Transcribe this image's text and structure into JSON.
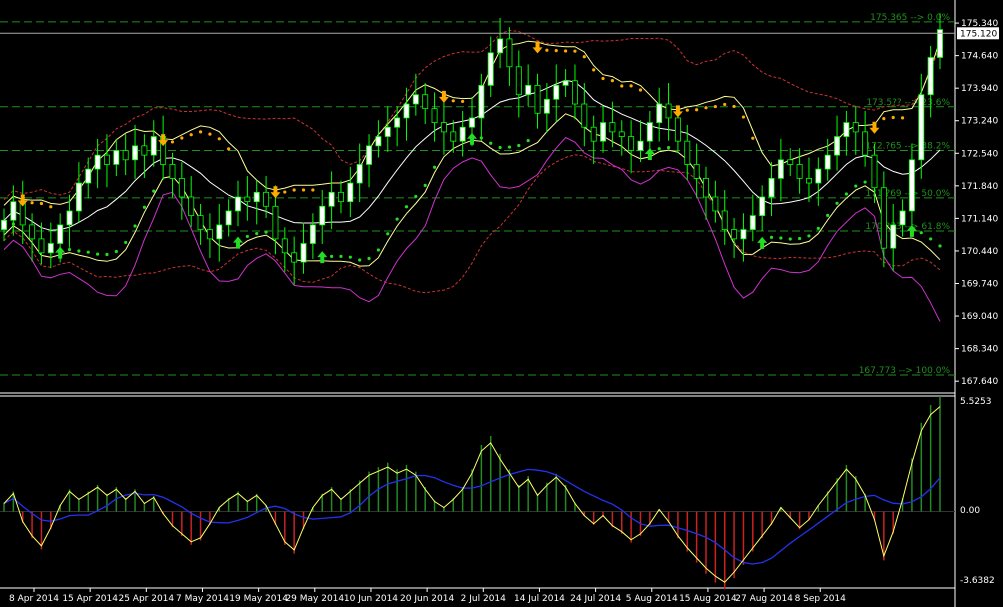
{
  "chart_data": [
    {
      "type": "candlestick",
      "panel": "price",
      "y_ticks": [
        "175.340",
        "174.640",
        "173.940",
        "173.240",
        "172.540",
        "171.840",
        "171.140",
        "170.440",
        "169.740",
        "169.040",
        "168.340",
        "167.640"
      ],
      "y_tick_values": [
        175.34,
        174.64,
        173.94,
        173.24,
        172.54,
        171.84,
        171.14,
        170.44,
        169.74,
        169.04,
        168.34,
        167.64
      ],
      "ylim": [
        167.45,
        175.75
      ],
      "current_price": "175.120",
      "current_price_value": 175.12,
      "fib_levels": [
        {
          "label": "175.365 --> 0.0%",
          "value": 175.365
        },
        {
          "label": "173.5?? --> 23.6%",
          "value": 173.54
        },
        {
          "label": "172.?65 --> 38.2%",
          "value": 172.6
        },
        {
          "label": "171.?69 --> 50.0%",
          "value": 171.58
        },
        {
          "label": "170.?73 --> 61.8%",
          "value": 170.87
        },
        {
          "label": "167.773 --> 100.0%",
          "value": 167.773
        }
      ],
      "closes": [
        171.1,
        171.5,
        171.0,
        170.7,
        170.4,
        170.6,
        171.0,
        171.3,
        171.9,
        172.2,
        172.5,
        172.3,
        172.6,
        172.4,
        172.7,
        172.5,
        172.9,
        172.3,
        172.0,
        171.6,
        171.2,
        170.9,
        170.7,
        171.0,
        171.3,
        171.6,
        171.5,
        171.7,
        171.4,
        170.7,
        170.4,
        170.2,
        170.6,
        171.0,
        171.4,
        171.7,
        171.5,
        171.9,
        172.3,
        172.7,
        172.9,
        173.1,
        173.3,
        173.6,
        173.8,
        173.5,
        173.2,
        173.0,
        172.8,
        173.1,
        173.3,
        174.0,
        174.7,
        175.0,
        174.4,
        173.8,
        174.0,
        173.4,
        173.7,
        174.0,
        174.1,
        173.6,
        173.1,
        172.8,
        173.2,
        173.0,
        172.9,
        172.6,
        172.8,
        173.2,
        173.6,
        173.3,
        172.8,
        172.3,
        172.0,
        171.6,
        171.3,
        170.9,
        170.7,
        170.9,
        171.2,
        171.6,
        172.0,
        172.4,
        172.3,
        172.0,
        171.9,
        172.2,
        172.5,
        172.9,
        173.2,
        173.0,
        172.5,
        171.8,
        170.5,
        171.0,
        171.3,
        172.4,
        173.8,
        174.6,
        175.2
      ],
      "oscillator_ticks": [
        "5.5253",
        "0.00",
        "-3.6382"
      ],
      "oscillator_values": [
        0.4,
        0.9,
        -0.5,
        -1.2,
        -1.7,
        -0.8,
        0.3,
        1.0,
        0.6,
        0.9,
        1.2,
        0.8,
        1.1,
        0.6,
        1.0,
        0.4,
        0.7,
        -0.1,
        -0.7,
        -1.1,
        -1.5,
        -1.3,
        -0.6,
        0.2,
        0.6,
        0.9,
        0.5,
        0.8,
        0.3,
        -0.6,
        -1.5,
        -1.9,
        -0.8,
        0.2,
        0.8,
        1.1,
        0.6,
        1.0,
        1.4,
        1.8,
        2.0,
        2.2,
        1.9,
        2.1,
        1.8,
        1.1,
        0.5,
        0.2,
        0.6,
        1.1,
        1.9,
        3.0,
        3.4,
        2.6,
        1.9,
        1.2,
        1.6,
        0.8,
        1.3,
        1.7,
        1.2,
        0.4,
        -0.2,
        -0.6,
        -0.2,
        -0.7,
        -1.0,
        -1.4,
        -1.1,
        -0.6,
        0.1,
        -0.5,
        -1.2,
        -1.8,
        -2.3,
        -2.8,
        -3.2,
        -3.5,
        -3.0,
        -2.4,
        -1.8,
        -1.2,
        -0.6,
        0.2,
        -0.3,
        -0.8,
        -0.4,
        0.3,
        0.9,
        1.5,
        2.1,
        1.6,
        0.8,
        -0.4,
        -2.2,
        -1.0,
        0.6,
        2.4,
        4.0,
        4.8,
        5.2
      ],
      "oscillator_ylim": [
        -3.6382,
        5.5253
      ],
      "x_tick_labels": [
        "8 Apr 2014",
        "15 Apr 2014",
        "25 Apr 2014",
        "7 May 2014",
        "19 May 2014",
        "29 May 2014",
        "10 Jun 2014",
        "20 Jun 2014",
        "2 Jul 2014",
        "14 Jul 2014",
        "24 Jul 2014",
        "5 Aug 2014",
        "15 Aug 2014",
        "27 Aug 2014",
        "8 Sep 2014"
      ],
      "x_tick_positions": [
        0,
        6,
        12,
        18,
        24,
        30,
        36,
        42,
        48,
        54,
        60,
        66,
        72,
        78,
        84
      ],
      "colors": {
        "bull": "#ffffff",
        "bear": "#000000",
        "wick": "#00ff00",
        "outer_band": "#cc3333",
        "inner_band": "#ffff99",
        "mid_line": "#ffffff",
        "magenta_line": "#cc33cc",
        "trail_green": "#22dd22",
        "trail_orange": "#ffaa00",
        "fib": "#1f8f1f",
        "hist_pos": "#228b22",
        "hist_neg": "#cc2222",
        "osc_yellow": "#ffff66",
        "osc_blue": "#2233ee"
      }
    }
  ]
}
